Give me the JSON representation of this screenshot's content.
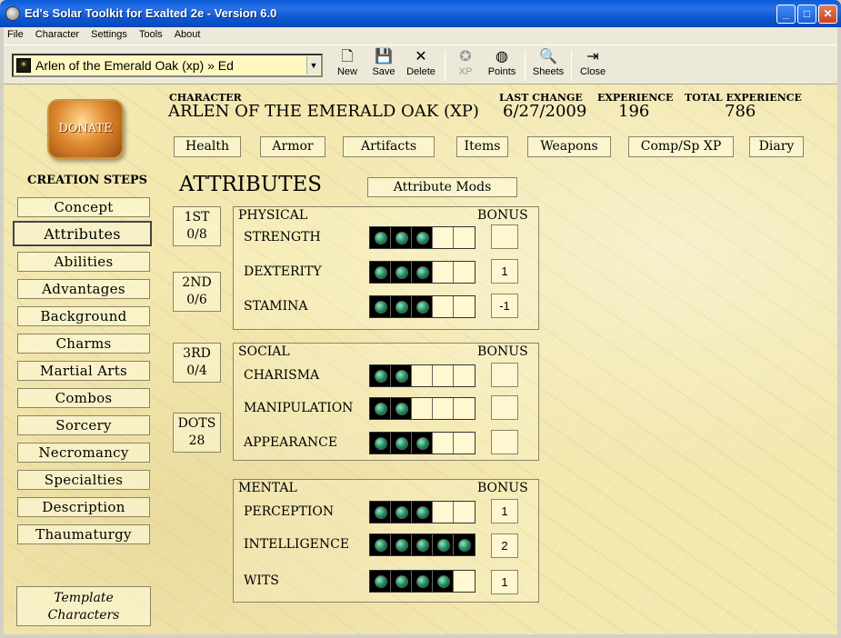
{
  "window": {
    "title": "Ed's Solar Toolkit for Exalted 2e - Version 6.0",
    "min": "_",
    "max": "□",
    "close": "✕"
  },
  "menu": [
    "File",
    "Character",
    "Settings",
    "Tools",
    "About"
  ],
  "toolbar": {
    "character_select": "Arlen of the Emerald Oak (xp) » Ed",
    "buttons": [
      {
        "label": "New",
        "icon": "🗋"
      },
      {
        "label": "Save",
        "icon": "💾"
      },
      {
        "label": "Delete",
        "icon": "✕"
      },
      {
        "label": "XP",
        "icon": "✪"
      },
      {
        "label": "Points",
        "icon": "◍"
      },
      {
        "label": "Sheets",
        "icon": "🔍"
      },
      {
        "label": "Close",
        "icon": "⇥"
      }
    ]
  },
  "donate": "DONATE",
  "header": {
    "character_label": "CHARACTER",
    "character_name": "ARLEN OF THE EMERALD OAK (XP)",
    "last_change_label": "LAST CHANGE",
    "last_change": "6/27/2009",
    "experience_label": "EXPERIENCE",
    "experience": "196",
    "total_experience_label": "TOTAL EXPERIENCE",
    "total_experience": "786"
  },
  "tabs": [
    "Health",
    "Armor",
    "Artifacts",
    "Items",
    "Weapons",
    "Comp/Sp XP",
    "Diary"
  ],
  "creation_steps": {
    "heading": "CREATION STEPS",
    "items": [
      "Concept",
      "Attributes",
      "Abilities",
      "Advantages",
      "Background",
      "Charms",
      "Martial Arts",
      "Combos",
      "Sorcery",
      "Necromancy",
      "Specialties",
      "Description",
      "Thaumaturgy"
    ],
    "active": "Attributes"
  },
  "template_button": "Template Characters",
  "attributes": {
    "title": "ATTRIBUTES",
    "mods_button": "Attribute Mods",
    "priorities": [
      {
        "rank": "1ST",
        "value": "0/8"
      },
      {
        "rank": "2ND",
        "value": "0/6"
      },
      {
        "rank": "3RD",
        "value": "0/4"
      },
      {
        "rank": "DOTS",
        "value": "28"
      }
    ],
    "bonus_label": "BONUS",
    "groups": [
      {
        "name": "PHYSICAL",
        "attrs": [
          {
            "name": "STRENGTH",
            "dots": 3,
            "bonus": ""
          },
          {
            "name": "DEXTERITY",
            "dots": 3,
            "bonus": "1"
          },
          {
            "name": "STAMINA",
            "dots": 3,
            "bonus": "-1"
          }
        ]
      },
      {
        "name": "SOCIAL",
        "attrs": [
          {
            "name": "CHARISMA",
            "dots": 2,
            "bonus": ""
          },
          {
            "name": "MANIPULATION",
            "dots": 2,
            "bonus": ""
          },
          {
            "name": "APPEARANCE",
            "dots": 3,
            "bonus": ""
          }
        ]
      },
      {
        "name": "MENTAL",
        "attrs": [
          {
            "name": "PERCEPTION",
            "dots": 3,
            "bonus": "1"
          },
          {
            "name": "INTELLIGENCE",
            "dots": 5,
            "bonus": "2"
          },
          {
            "name": "WITS",
            "dots": 4,
            "bonus": "1"
          }
        ]
      }
    ]
  }
}
